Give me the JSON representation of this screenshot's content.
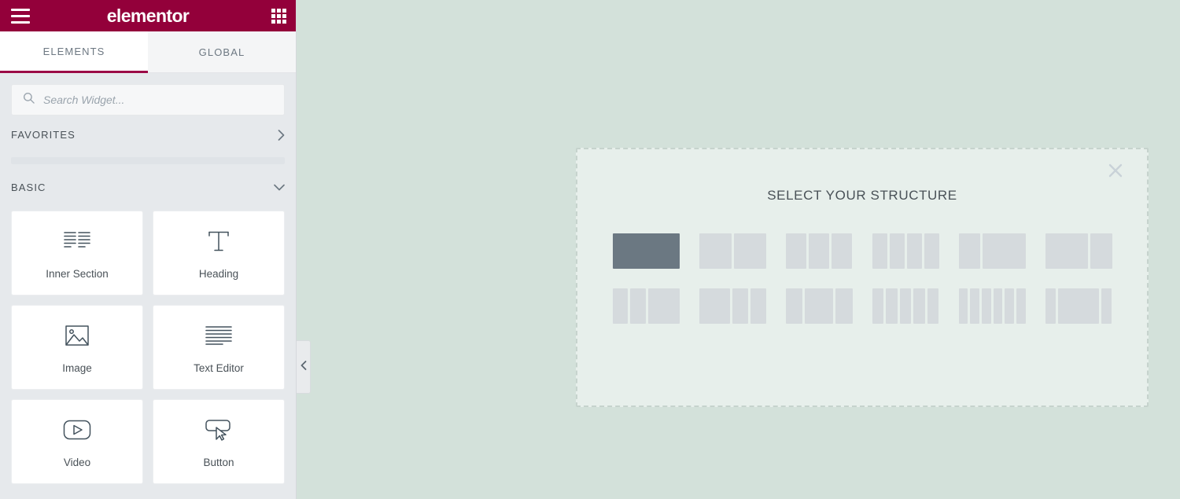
{
  "header": {
    "brand": "elementor",
    "menu_icon": "hamburger-icon",
    "apps_icon": "grid-apps-icon"
  },
  "tabs": [
    {
      "label": "ELEMENTS",
      "active": true
    },
    {
      "label": "GLOBAL",
      "active": false
    }
  ],
  "search": {
    "placeholder": "Search Widget...",
    "value": "",
    "icon": "search-icon"
  },
  "categories": [
    {
      "label": "FAVORITES",
      "state": "collapsed",
      "icon": "chevron-right-icon"
    },
    {
      "label": "BASIC",
      "state": "expanded",
      "icon": "chevron-down-icon"
    }
  ],
  "widgets": [
    {
      "label": "Inner Section",
      "icon": "inner-section-icon"
    },
    {
      "label": "Heading",
      "icon": "heading-t-icon"
    },
    {
      "label": "Image",
      "icon": "image-icon"
    },
    {
      "label": "Text Editor",
      "icon": "text-editor-icon"
    },
    {
      "label": "Video",
      "icon": "video-play-icon"
    },
    {
      "label": "Button",
      "icon": "button-cursor-icon"
    }
  ],
  "collapse_handle": {
    "icon": "chevron-left-icon"
  },
  "structure_panel": {
    "title": "SELECT YOUR STRUCTURE",
    "close_icon": "close-x-icon",
    "presets": [
      {
        "name": "one-column",
        "columns": [
          100
        ],
        "selected": true
      },
      {
        "name": "two-columns",
        "columns": [
          50,
          50
        ],
        "selected": false
      },
      {
        "name": "three-columns",
        "columns": [
          33,
          33,
          33
        ],
        "selected": false
      },
      {
        "name": "four-columns",
        "columns": [
          25,
          25,
          25,
          25
        ],
        "selected": false
      },
      {
        "name": "left-third-right-two-thirds",
        "columns": [
          33,
          67
        ],
        "selected": false
      },
      {
        "name": "left-two-thirds-right-third",
        "columns": [
          67,
          33
        ],
        "selected": false
      },
      {
        "name": "narrow-narrow-wide",
        "columns": [
          25,
          25,
          50
        ],
        "selected": false
      },
      {
        "name": "wide-narrow-narrow",
        "columns": [
          50,
          25,
          25
        ],
        "selected": false
      },
      {
        "name": "narrow-wide-narrow",
        "columns": [
          25,
          42,
          25
        ],
        "selected": false
      },
      {
        "name": "five-columns",
        "columns": [
          20,
          20,
          20,
          20,
          20
        ],
        "selected": false
      },
      {
        "name": "six-columns",
        "columns": [
          16,
          16,
          16,
          16,
          16,
          16
        ],
        "selected": false
      },
      {
        "name": "thin-wide-thin",
        "columns": [
          17,
          62,
          17
        ],
        "selected": false
      }
    ]
  },
  "colors": {
    "brand_red": "#93003a",
    "tab_underline": "#9b0a46",
    "sidebar_bg": "#e6e9ec",
    "canvas_bg": "#d3e1da",
    "panel_bg": "#e7efeb",
    "preset_col": "#d5dadd",
    "preset_selected": "#6b7882"
  }
}
